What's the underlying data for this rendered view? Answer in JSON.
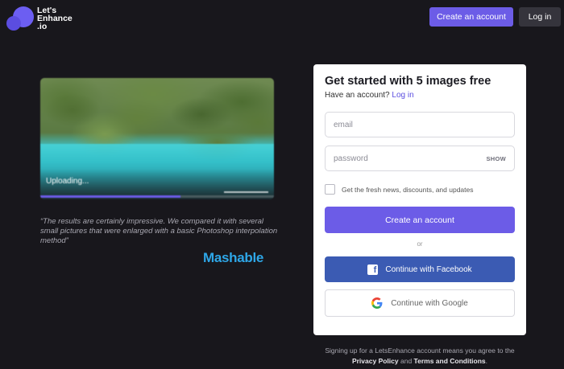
{
  "header": {
    "logo_lines": [
      "Let's",
      "Enhance",
      ".io"
    ],
    "create_account": "Create an account",
    "login": "Log in"
  },
  "preview": {
    "status": "Uploading...",
    "progress": 0.6
  },
  "testimonial": {
    "quote": "“The results are certainly impressive. We compared it with several small pictures that were enlarged with a basic Photoshop interpolation method”",
    "source": "Mashable"
  },
  "signup": {
    "title": "Get started with 5 images free",
    "have_account": "Have an account?",
    "login_link": "Log in",
    "email_placeholder": "email",
    "password_placeholder": "password",
    "show_label": "SHOW",
    "newsletter_label": "Get the fresh news, discounts, and updates",
    "create_button": "Create an account",
    "or": "or",
    "facebook_button": "Continue with Facebook",
    "google_button": "Continue with Google"
  },
  "legal": {
    "prefix": "Signing up for a LetsEnhance account means you agree to the",
    "privacy": "Privacy Policy",
    "and": "and",
    "terms": "Terms and Conditions",
    "suffix": "."
  },
  "colors": {
    "background": "#18171c",
    "accent": "#6c5ce7",
    "facebook": "#3b5bb3",
    "mashable": "#2ea7e8"
  }
}
